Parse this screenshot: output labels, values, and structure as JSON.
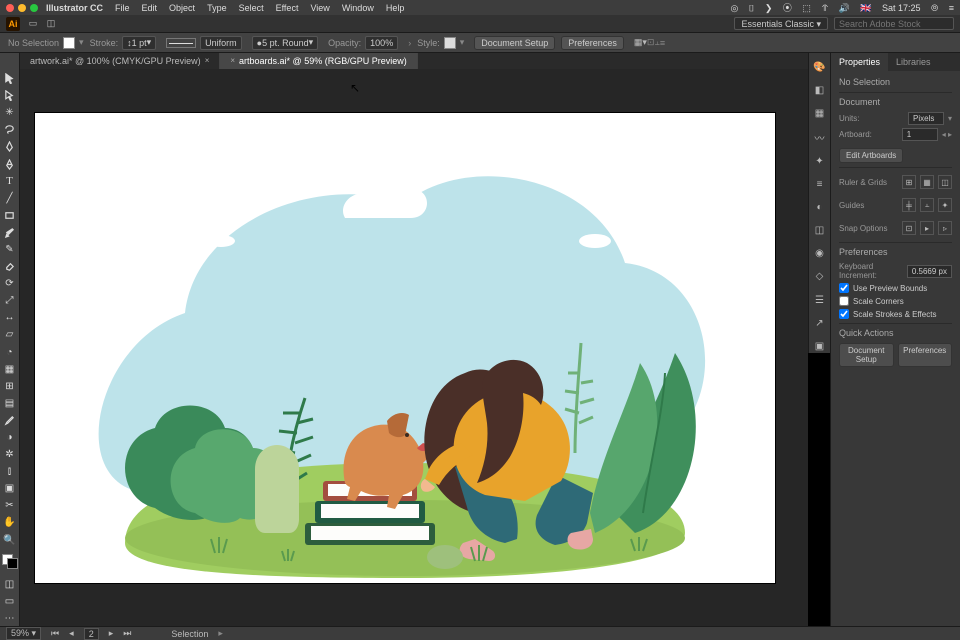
{
  "menubar": {
    "app": "Illustrator CC",
    "items": [
      "File",
      "Edit",
      "Object",
      "Type",
      "Select",
      "Effect",
      "View",
      "Window",
      "Help"
    ],
    "clock": "Sat 17:25"
  },
  "appbar": {
    "workspace": "Essentials Classic",
    "search_placeholder": "Search Adobe Stock"
  },
  "controlbar": {
    "selection": "No Selection",
    "stroke_label": "Stroke:",
    "stroke_value": "1 pt",
    "profile": "Uniform",
    "brush": "5 pt. Round",
    "opacity_label": "Opacity:",
    "opacity_value": "100%",
    "style_label": "Style:",
    "docsetup": "Document Setup",
    "prefs": "Preferences"
  },
  "tabs": [
    {
      "label": "artwork.ai* @ 100% (CMYK/GPU Preview)",
      "active": false
    },
    {
      "label": "artboards.ai* @ 59% (RGB/GPU Preview)",
      "active": true
    }
  ],
  "panel": {
    "tabs": [
      "Properties",
      "Libraries"
    ],
    "noselection": "No Selection",
    "document_hdr": "Document",
    "units_label": "Units:",
    "units_value": "Pixels",
    "artboard_label": "Artboard:",
    "artboard_value": "1",
    "edit_artboards": "Edit Artboards",
    "ruler_grids": "Ruler & Grids",
    "guides": "Guides",
    "snap": "Snap Options",
    "prefs_hdr": "Preferences",
    "keyincr_label": "Keyboard Increment:",
    "keyincr_value": "0.5669 px",
    "chk_preview": "Use Preview Bounds",
    "chk_corners": "Scale Corners",
    "chk_strokes": "Scale Strokes & Effects",
    "quick_hdr": "Quick Actions",
    "qa_docsetup": "Document Setup",
    "qa_prefs": "Preferences"
  },
  "statusbar": {
    "zoom": "59%",
    "artboard_idx": "2",
    "mode": "Selection"
  }
}
